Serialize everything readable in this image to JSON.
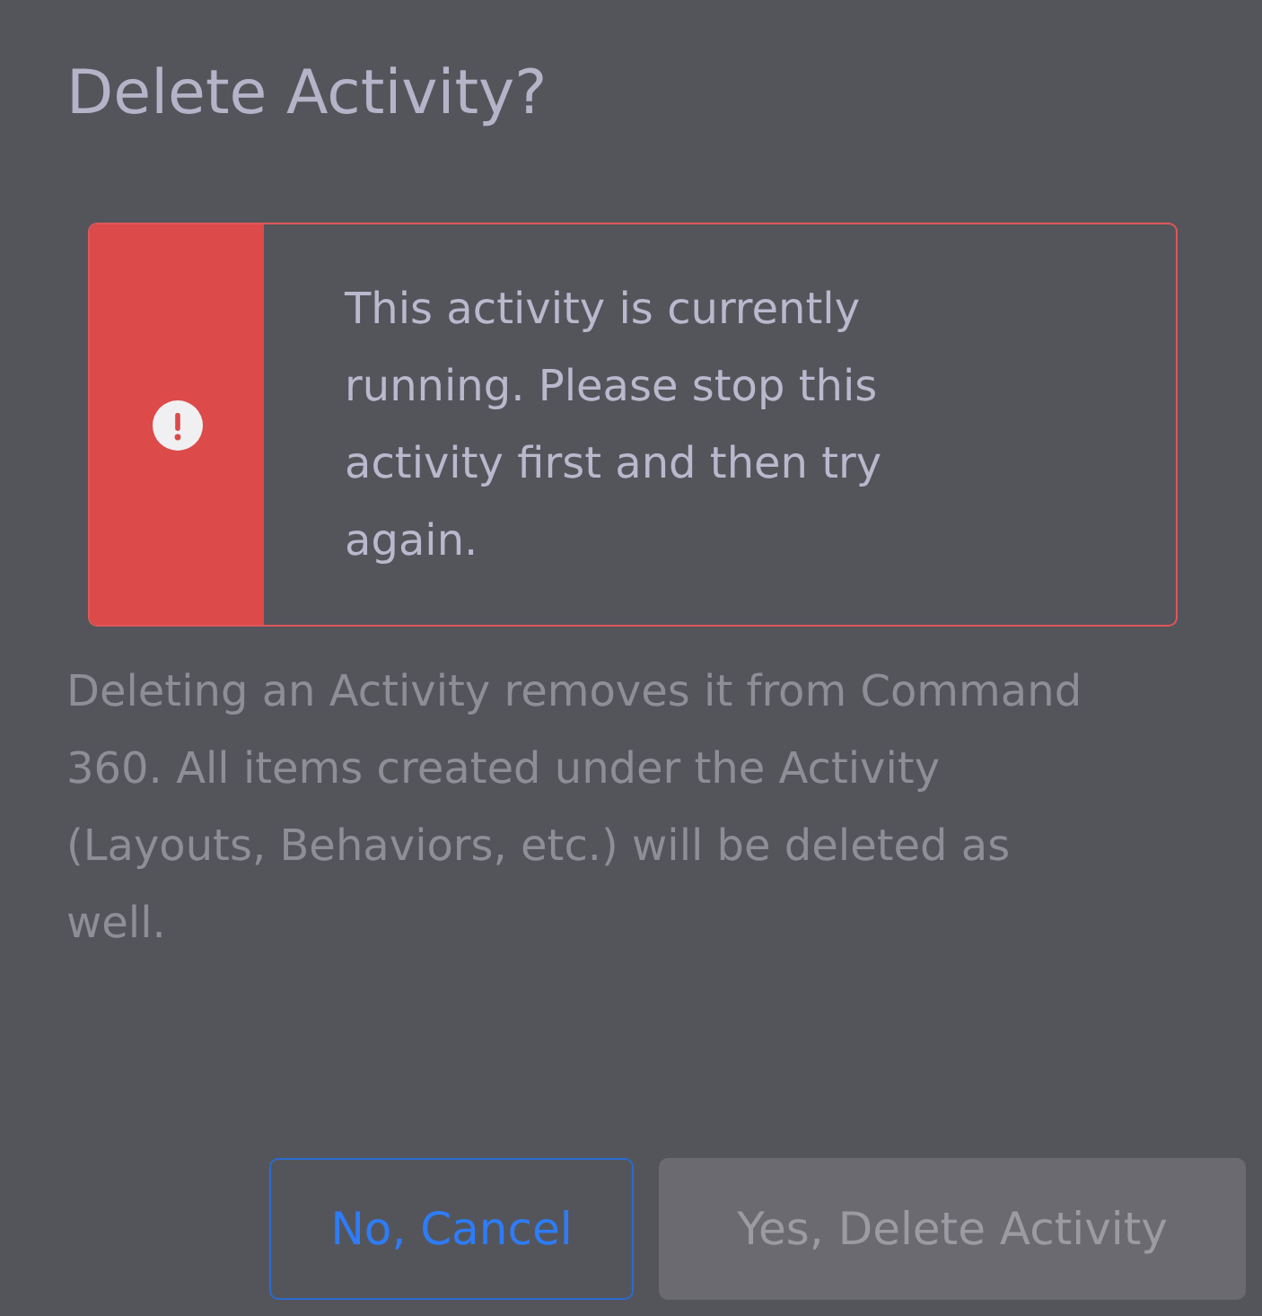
{
  "dialog": {
    "title": "Delete Activity?",
    "alert": {
      "kind": "error",
      "message": "This activity is currently running. Please stop this activity first and then try again."
    },
    "description": "Deleting an Activity removes it from Command 360. All items created under the Activity (Layouts, Behaviors, etc.) will be deleted as well.",
    "buttons": [
      {
        "label": "No, Cancel",
        "kind": "secondary",
        "disabled": false
      },
      {
        "label": "Yes, Delete Activity",
        "kind": "primary",
        "disabled": true
      }
    ]
  }
}
